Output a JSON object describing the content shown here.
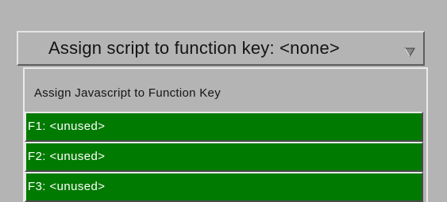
{
  "dropdown": {
    "label": "Assign script to function key: <none>",
    "arrow_icon": "triangle-down-icon"
  },
  "menu": {
    "title": "Assign Javascript to Function Key",
    "items": [
      {
        "label": "F1: <unused>"
      },
      {
        "label": "F2: <unused>"
      },
      {
        "label": "F3: <unused>"
      }
    ]
  },
  "colors": {
    "background": "#b4b4b4",
    "item_green": "#007a00",
    "item_text": "#ffffff"
  }
}
